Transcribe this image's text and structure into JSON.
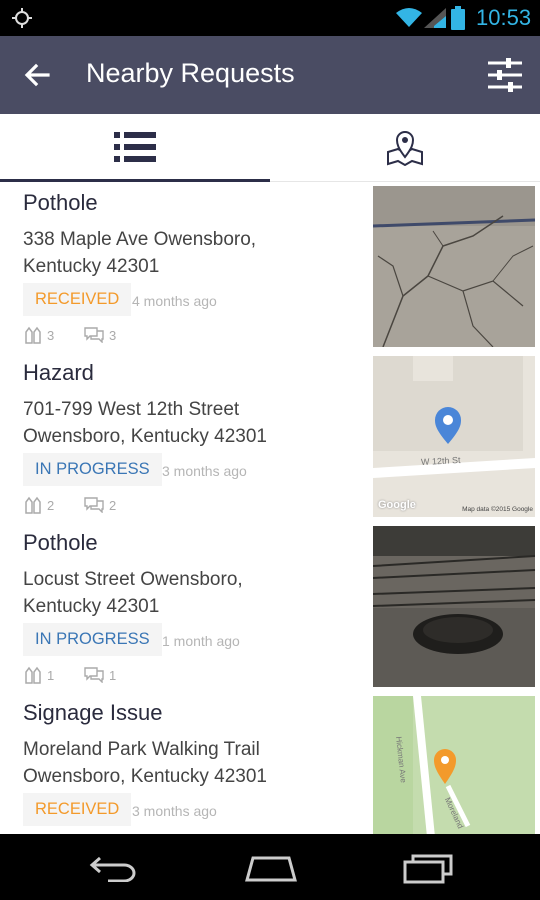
{
  "status_bar": {
    "time": "10:53",
    "accent_color": "#33b5e5",
    "icons": [
      "gps-icon",
      "wifi-icon",
      "signal-icon",
      "battery-icon"
    ]
  },
  "app_bar": {
    "title": "Nearby Requests",
    "background_color": "#4a4c63",
    "icons": [
      "back-arrow-icon",
      "filter-sliders-icon"
    ]
  },
  "tabs": [
    {
      "name": "list",
      "icon": "list-icon",
      "selected": true
    },
    {
      "name": "map",
      "icon": "map-pin-icon",
      "selected": false
    }
  ],
  "requests": [
    {
      "type": "Pothole",
      "address_line1": "338  Maple Ave Owensboro,",
      "address_line2": "Kentucky 42301",
      "status": "RECEIVED",
      "status_color": "#f39a2b",
      "time_ago": "4 months ago",
      "votes": "3",
      "comments": "3",
      "thumbnail": "cracked-pavement-photo"
    },
    {
      "type": "Hazard",
      "address_line1": "701-799  West 12th Street",
      "address_line2": "Owensboro, Kentucky 42301",
      "status": "IN PROGRESS",
      "status_color": "#3a76b5",
      "time_ago": "3 months ago",
      "votes": "2",
      "comments": "2",
      "thumbnail": "map-thumbnail",
      "map_street": "W 12th St",
      "map_attribution": "Map data ©2015 Google",
      "map_logo": "Google",
      "pin_color": "#4a86d8"
    },
    {
      "type": "Pothole",
      "address_line1": "Locust Street Owensboro,",
      "address_line2": "Kentucky 42301",
      "status": "IN PROGRESS",
      "status_color": "#3a76b5",
      "time_ago": "1 month ago",
      "votes": "1",
      "comments": "1",
      "thumbnail": "pothole-photo"
    },
    {
      "type": "Signage Issue",
      "address_line1": "Moreland Park Walking Trail",
      "address_line2": "Owensboro, Kentucky 42301",
      "status": "RECEIVED",
      "status_color": "#f39a2b",
      "time_ago": "3 months ago",
      "votes": "",
      "comments": "",
      "thumbnail": "map-thumbnail",
      "map_street": "Hickman Ave",
      "map_street2": "Moreland",
      "pin_color": "#f39a2b"
    }
  ],
  "nav_bar": {
    "icons": [
      "nav-back-icon",
      "nav-home-icon",
      "nav-recents-icon"
    ]
  }
}
